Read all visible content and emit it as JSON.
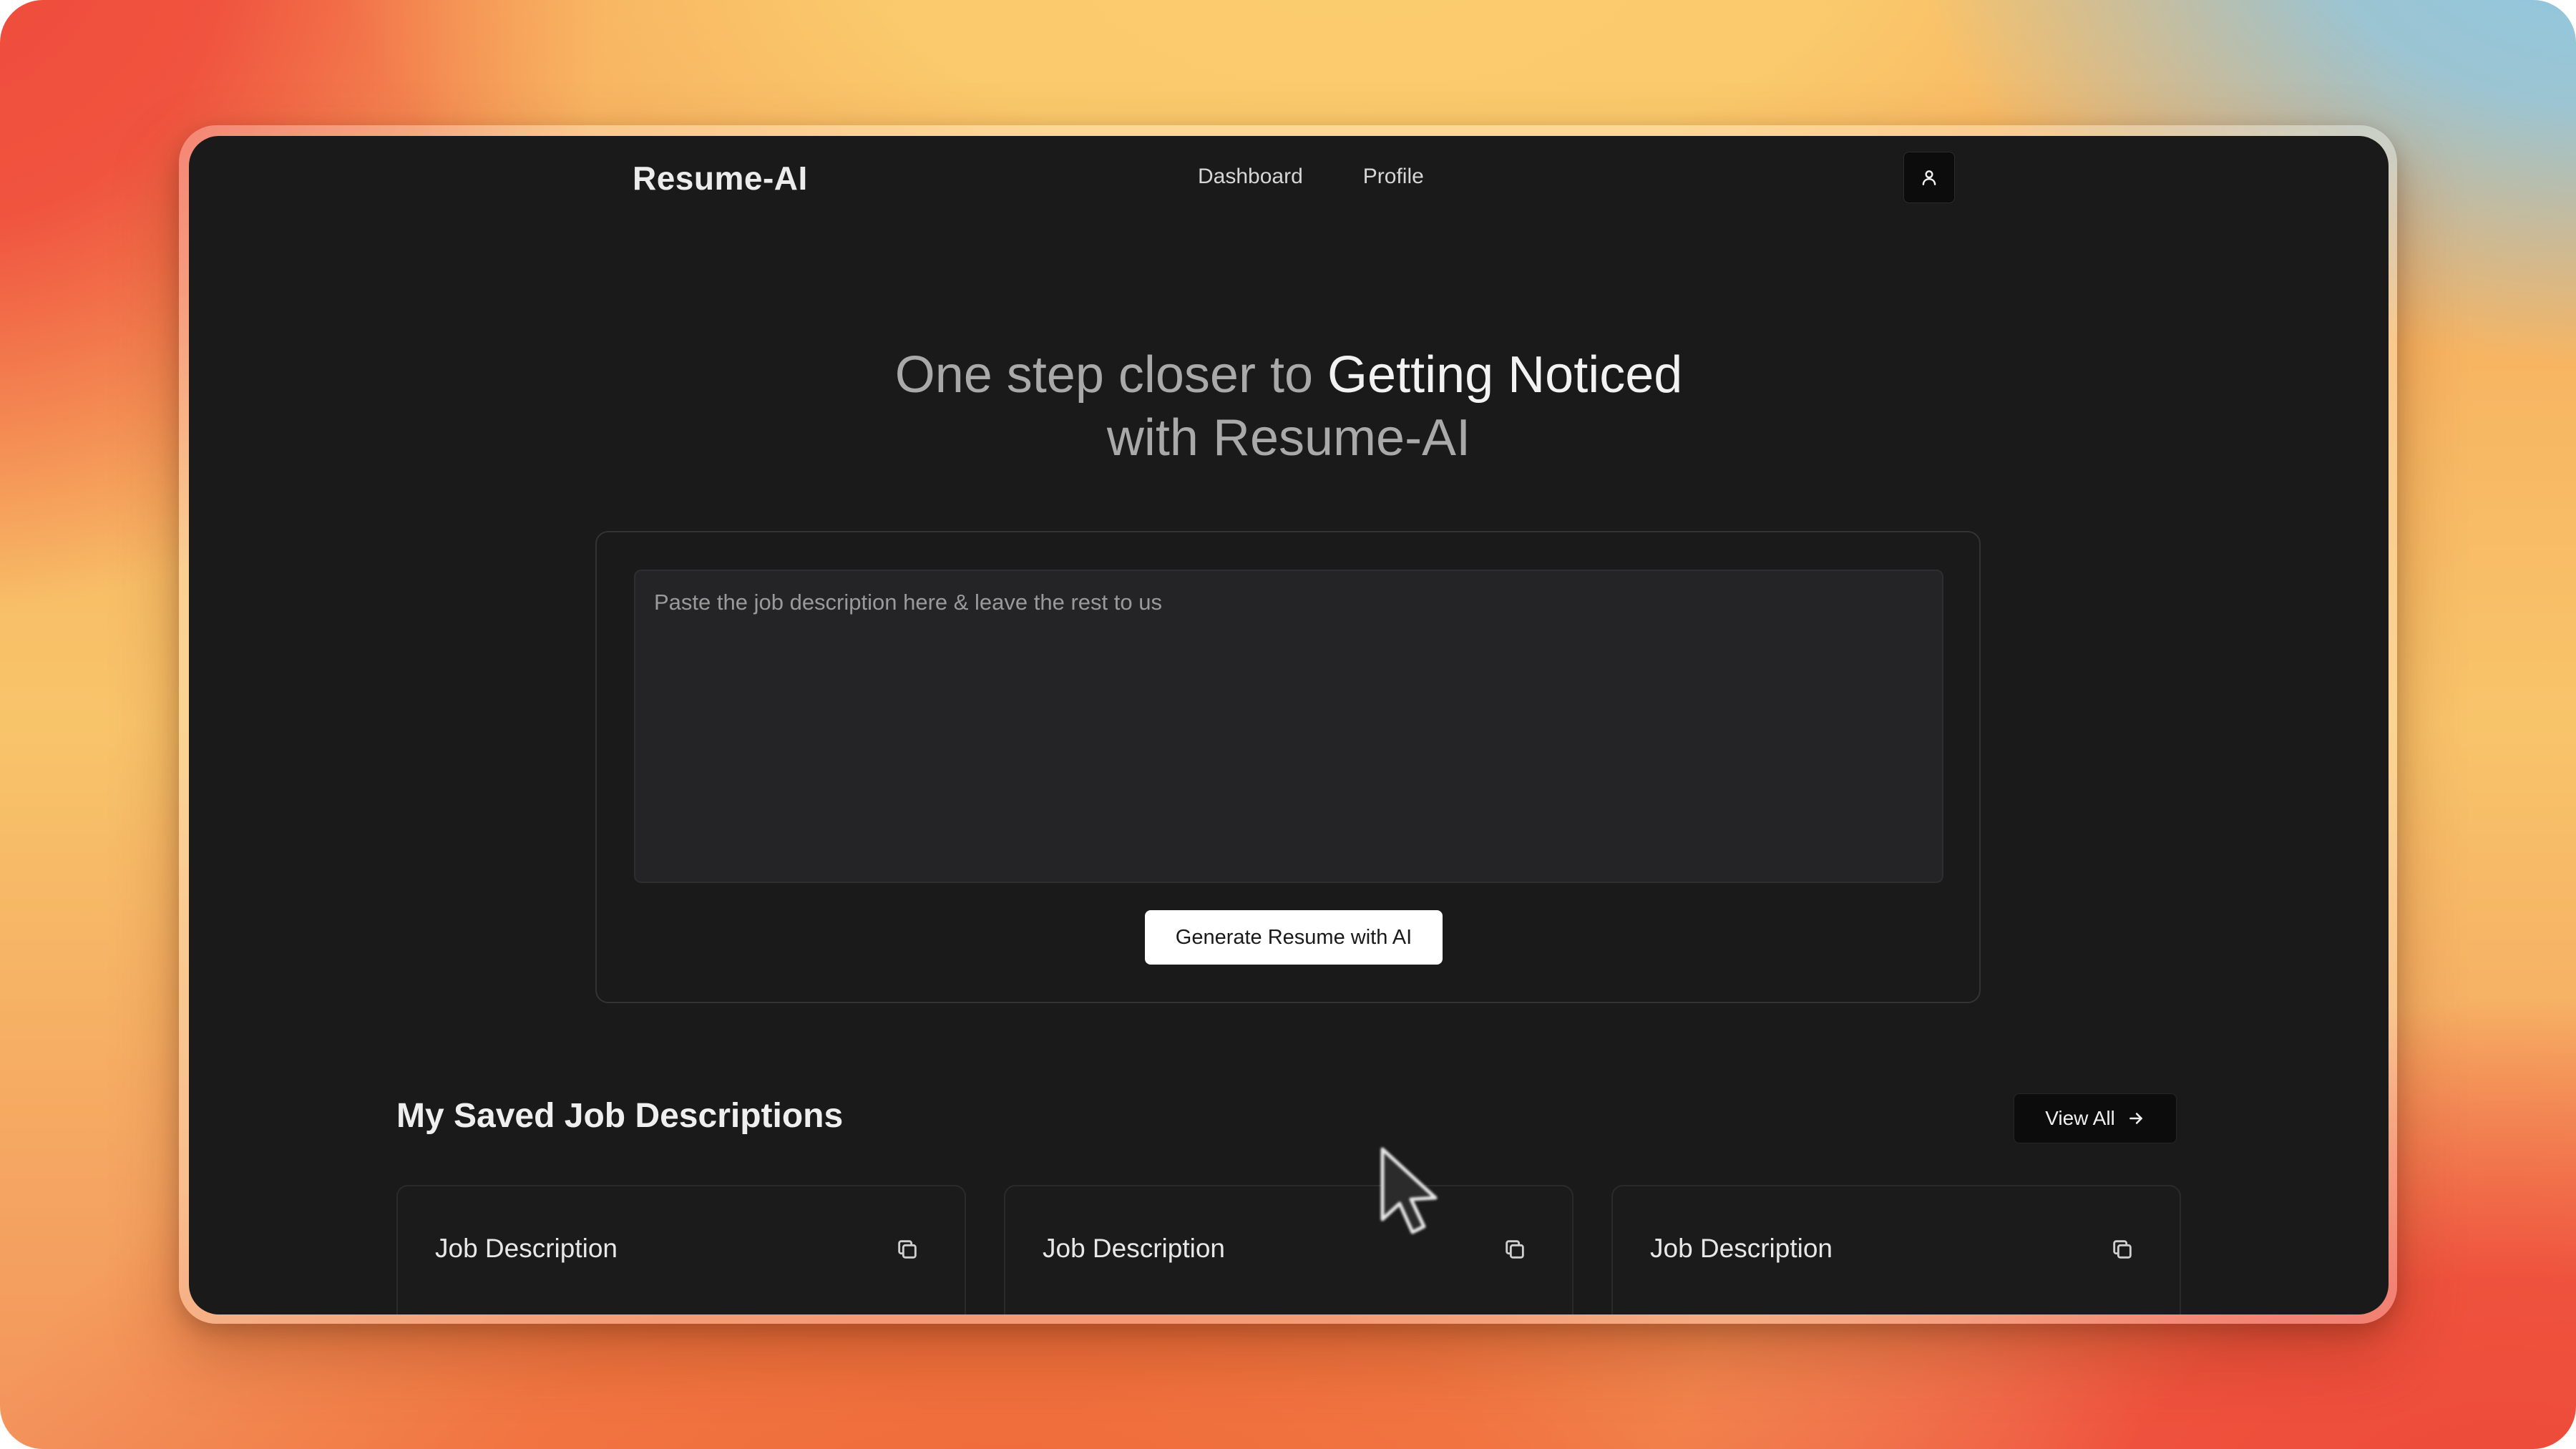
{
  "app": {
    "brand": "Resume-AI"
  },
  "nav": {
    "links": [
      "Dashboard",
      "Profile"
    ]
  },
  "hero": {
    "prefix": "One step closer to ",
    "highlight": "Getting Noticed",
    "suffix": "with Resume-AI"
  },
  "compose": {
    "placeholder": "Paste the job description here & leave the rest to us",
    "value": "",
    "generate_label": "Generate Resume with AI"
  },
  "saved": {
    "title": "My Saved Job Descriptions",
    "view_all_label": "View All",
    "cards": [
      {
        "title": "Job Description"
      },
      {
        "title": "Job Description"
      },
      {
        "title": "Job Description"
      }
    ]
  },
  "icons": {
    "profile": "user-icon",
    "view_all": "arrow-right-icon",
    "copy": "copy-icon",
    "cursor": "mouse-pointer-icon"
  }
}
